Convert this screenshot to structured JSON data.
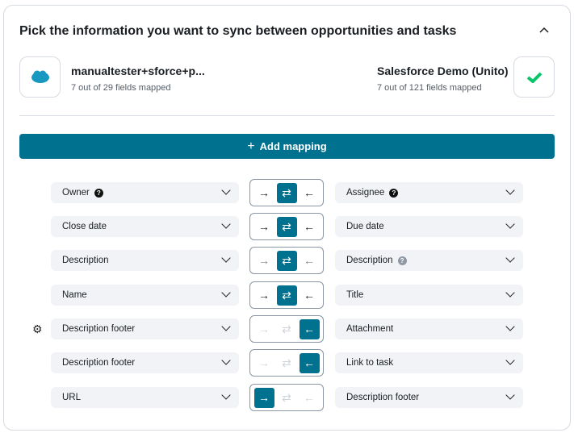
{
  "header": {
    "title": "Pick the information you want to sync between opportunities and tasks",
    "collapse_icon": "chevron-up-icon"
  },
  "left_app": {
    "name": "manualtester+sforce+p...",
    "fields": "7 out of 29 fields mapped",
    "logo": "salesforce-logo",
    "logo_text": "salesforce"
  },
  "right_app": {
    "name": "Salesforce Demo (Unito)",
    "fields": "7 out of 121 fields mapped",
    "logo": "wrike-check-logo"
  },
  "add_mapping": {
    "label": "Add mapping",
    "icon": "plus-icon"
  },
  "colors": {
    "accent": "#00728f",
    "logo_blue": "#1798c1",
    "check_green": "#08c56a"
  },
  "mappings": [
    {
      "left": "Owner",
      "left_help": "?",
      "right": "Assignee",
      "right_help": "?",
      "direction": "both",
      "icons": {
        "to_right": "→",
        "both": "⇄",
        "to_left": "←"
      }
    },
    {
      "left": "Close date",
      "right": "Due date",
      "direction": "both"
    },
    {
      "left": "Description",
      "right": "Description",
      "right_help": "?",
      "direction": "both"
    },
    {
      "left": "Name",
      "right": "Title",
      "direction": "both"
    },
    {
      "left": "Description footer",
      "right": "Attachment",
      "direction": "to_left",
      "gear": "gear-icon"
    },
    {
      "left": "Description footer",
      "right": "Link to task",
      "direction": "to_left"
    },
    {
      "left": "URL",
      "right": "Description footer",
      "direction": "to_right"
    }
  ]
}
